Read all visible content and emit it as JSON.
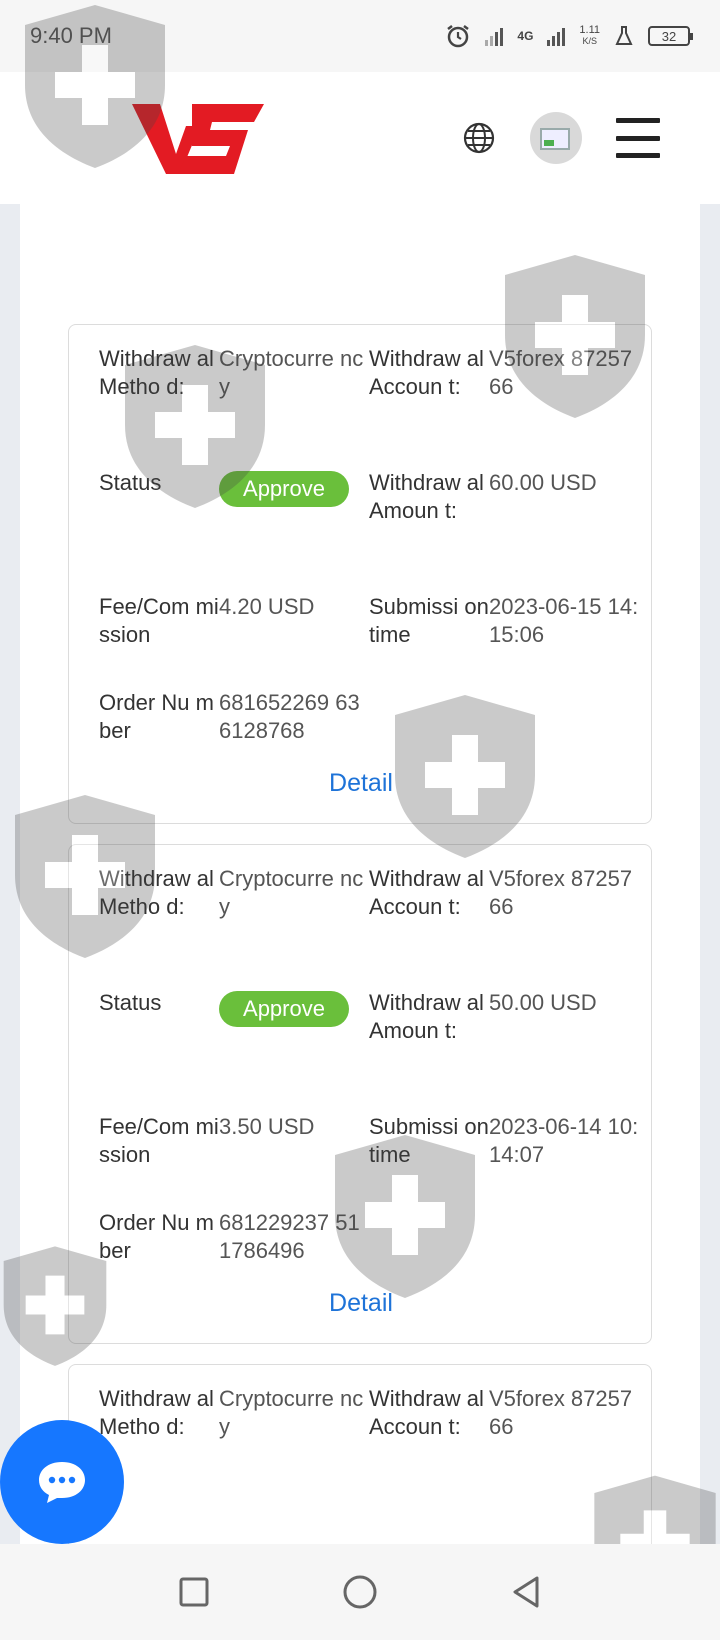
{
  "status_bar": {
    "time": "9:40 PM",
    "network": "4G",
    "speed_value": "1.11",
    "speed_unit": "K/S",
    "battery": "32"
  },
  "header": {
    "logo_text": "V5",
    "brand_color": "#e31b23"
  },
  "cards": [
    {
      "method_label": "Withdraw al Metho d:",
      "method_value": "Cryptocurre ncy",
      "account_label": "Withdraw al Accoun t:",
      "account_value": "V5forex 8725766",
      "status_label": "Status",
      "status_value": "Approve",
      "amount_label": "Withdraw al Amoun t:",
      "amount_value": "60.00 USD",
      "fee_label": "Fee/Com mission",
      "fee_value": "4.20 USD",
      "time_label": "Submissi on time",
      "time_value": "2023-06-15 14:15:06",
      "order_label": "Order Nu mber",
      "order_value": "681652269 636128768",
      "detail_label": "Detail"
    },
    {
      "method_label": "Withdraw al Metho d:",
      "method_value": "Cryptocurre ncy",
      "account_label": "Withdraw al Accoun t:",
      "account_value": "V5forex 8725766",
      "status_label": "Status",
      "status_value": "Approve",
      "amount_label": "Withdraw al Amoun t:",
      "amount_value": "50.00 USD",
      "fee_label": "Fee/Com mission",
      "fee_value": "3.50 USD",
      "time_label": "Submissi on time",
      "time_value": "2023-06-14 10:14:07",
      "order_label": "Order Nu mber",
      "order_value": "681229237 511786496",
      "detail_label": "Detail"
    },
    {
      "method_label": "Withdraw al Metho d:",
      "method_value": "Cryptocurre ncy",
      "account_label": "Withdraw al Accoun t:",
      "account_value": "V5forex 8725766"
    }
  ],
  "colors": {
    "approve": "#6abf3b",
    "link": "#1e73d8",
    "chat": "#1677ff"
  },
  "icons": {
    "globe": "globe-icon",
    "avatar": "avatar-image-icon",
    "menu": "hamburger-menu-icon",
    "chat": "chat-bubble-icon",
    "nav_recent": "square-icon",
    "nav_home": "circle-icon",
    "nav_back": "triangle-back-icon"
  }
}
